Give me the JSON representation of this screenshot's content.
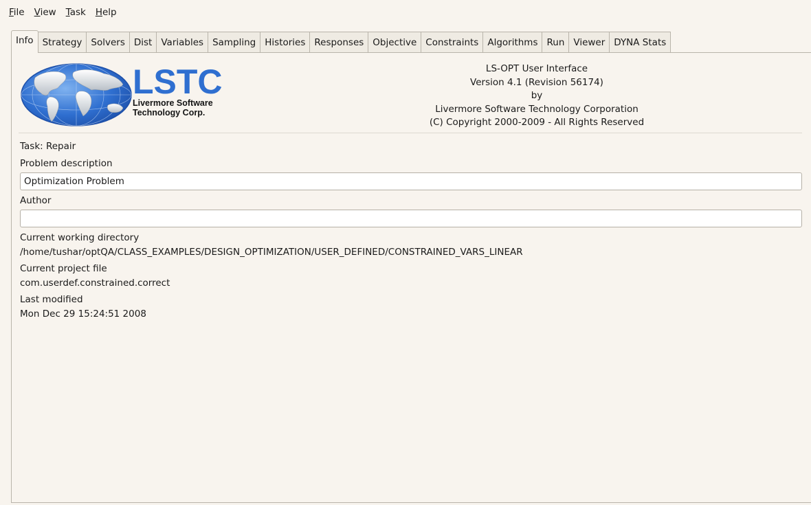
{
  "menu": {
    "items": [
      {
        "accel": "F",
        "rest": "ile"
      },
      {
        "accel": "V",
        "rest": "iew"
      },
      {
        "accel": "T",
        "rest": "ask"
      },
      {
        "accel": "H",
        "rest": "elp"
      }
    ]
  },
  "tabs": [
    "Info",
    "Strategy",
    "Solvers",
    "Dist",
    "Variables",
    "Sampling",
    "Histories",
    "Responses",
    "Objective",
    "Constraints",
    "Algorithms",
    "Run",
    "Viewer",
    "DYNA Stats"
  ],
  "logo": {
    "big": "LSTC",
    "line1": "Livermore Software",
    "line2": "Technology Corp."
  },
  "about": {
    "line1": "LS-OPT User Interface",
    "line2": "Version 4.1 (Revision 56174)",
    "line3": "by",
    "line4": "Livermore Software Technology Corporation",
    "line5": "(C) Copyright 2000-2009 - All Rights Reserved"
  },
  "info": {
    "task": "Task:  Repair",
    "problem_label": "Problem description",
    "problem_value": "Optimization Problem",
    "author_label": "Author",
    "author_value": "",
    "cwd_label": "Current working directory",
    "cwd_value": "/home/tushar/optQA/CLASS_EXAMPLES/DESIGN_OPTIMIZATION/USER_DEFINED/CONSTRAINED_VARS_LINEAR",
    "project_label": "Current project file",
    "project_value": "com.userdef.constrained.correct",
    "modified_label": "Last modified",
    "modified_value": "Mon Dec 29 15:24:51 2008"
  },
  "colors": {
    "background": "#f8f4ee",
    "logo_blue": "#2f6fd0"
  }
}
